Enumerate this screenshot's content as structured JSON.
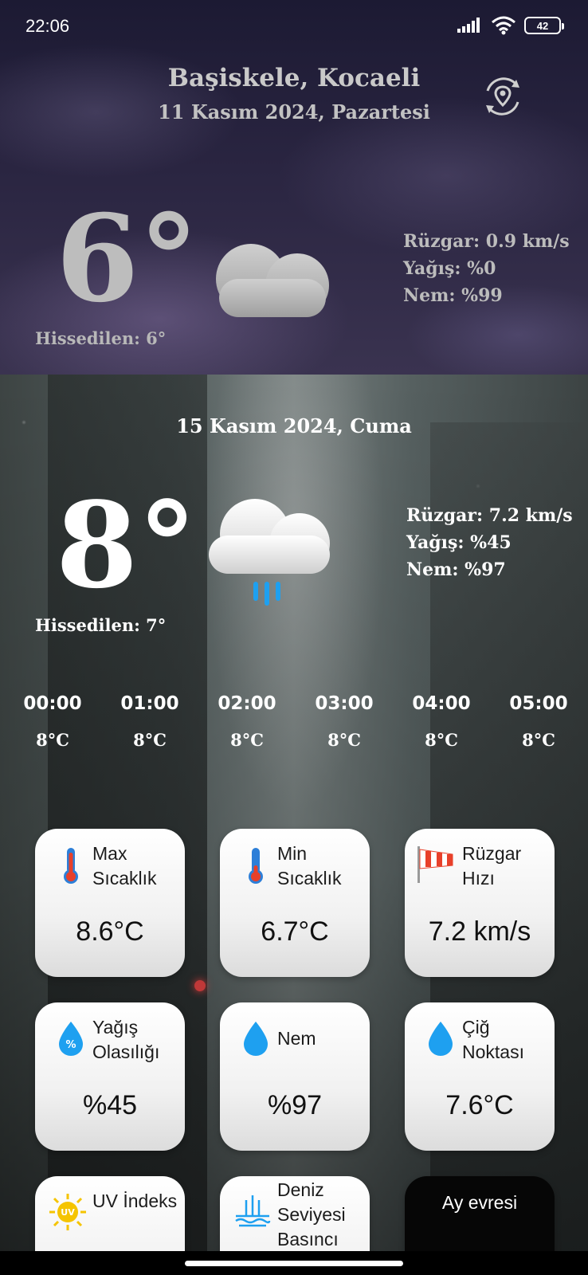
{
  "status_bar": {
    "time": "22:06",
    "battery": "42"
  },
  "current": {
    "city": "Başiskele, Kocaeli",
    "date": "11 Kasım 2024, Pazartesi",
    "temperature": "6°",
    "feels_like": "Hissedilen: 6°",
    "wind": "Rüzgar: 0.9 km/s",
    "precipitation": "Yağış: %0",
    "humidity": "Nem: %99",
    "icon": "partly-cloudy-night-icon"
  },
  "forecast": {
    "date": "15 Kasım 2024, Cuma",
    "temperature": "8°",
    "feels_like": "Hissedilen: 7°",
    "wind": "Rüzgar: 7.2 km/s",
    "precipitation": "Yağış: %45",
    "humidity": "Nem: %97",
    "icon": "rain-cloud-icon"
  },
  "hourly": [
    {
      "time": "00:00",
      "temp": "8°C"
    },
    {
      "time": "01:00",
      "temp": "8°C"
    },
    {
      "time": "02:00",
      "temp": "8°C"
    },
    {
      "time": "03:00",
      "temp": "8°C"
    },
    {
      "time": "04:00",
      "temp": "8°C"
    },
    {
      "time": "05:00",
      "temp": "8°C"
    }
  ],
  "cards": {
    "max_temp": {
      "label": "Max Sıcaklık",
      "value": "8.6°C",
      "icon": "thermometer-hot-icon"
    },
    "min_temp": {
      "label": "Min Sıcaklık",
      "value": "6.7°C",
      "icon": "thermometer-cold-icon"
    },
    "wind_speed": {
      "label": "Rüzgar Hızı",
      "value": "7.2 km/s",
      "icon": "windsock-icon"
    },
    "rain_chance": {
      "label": "Yağış Olasılığı",
      "value": "%45",
      "icon": "rain-percent-drop-icon"
    },
    "humidity": {
      "label": "Nem",
      "value": "%97",
      "icon": "water-drop-icon"
    },
    "dew_point": {
      "label": "Çiğ Noktası",
      "value": "7.6°C",
      "icon": "water-drop-icon"
    },
    "uv_index": {
      "label": "UV İndeks",
      "icon": "uv-sun-icon",
      "badge": "UV"
    },
    "sea_level_pressure": {
      "label": "Deniz Seviyesi Basıncı",
      "icon": "sea-level-icon"
    },
    "moon_phase": {
      "label": "Ay evresi",
      "icon": "moon-icon"
    }
  },
  "colors": {
    "accent_blue": "#1ea0f0",
    "thermometer_red": "#e8402a",
    "moon_yellow": "#d7b716"
  }
}
